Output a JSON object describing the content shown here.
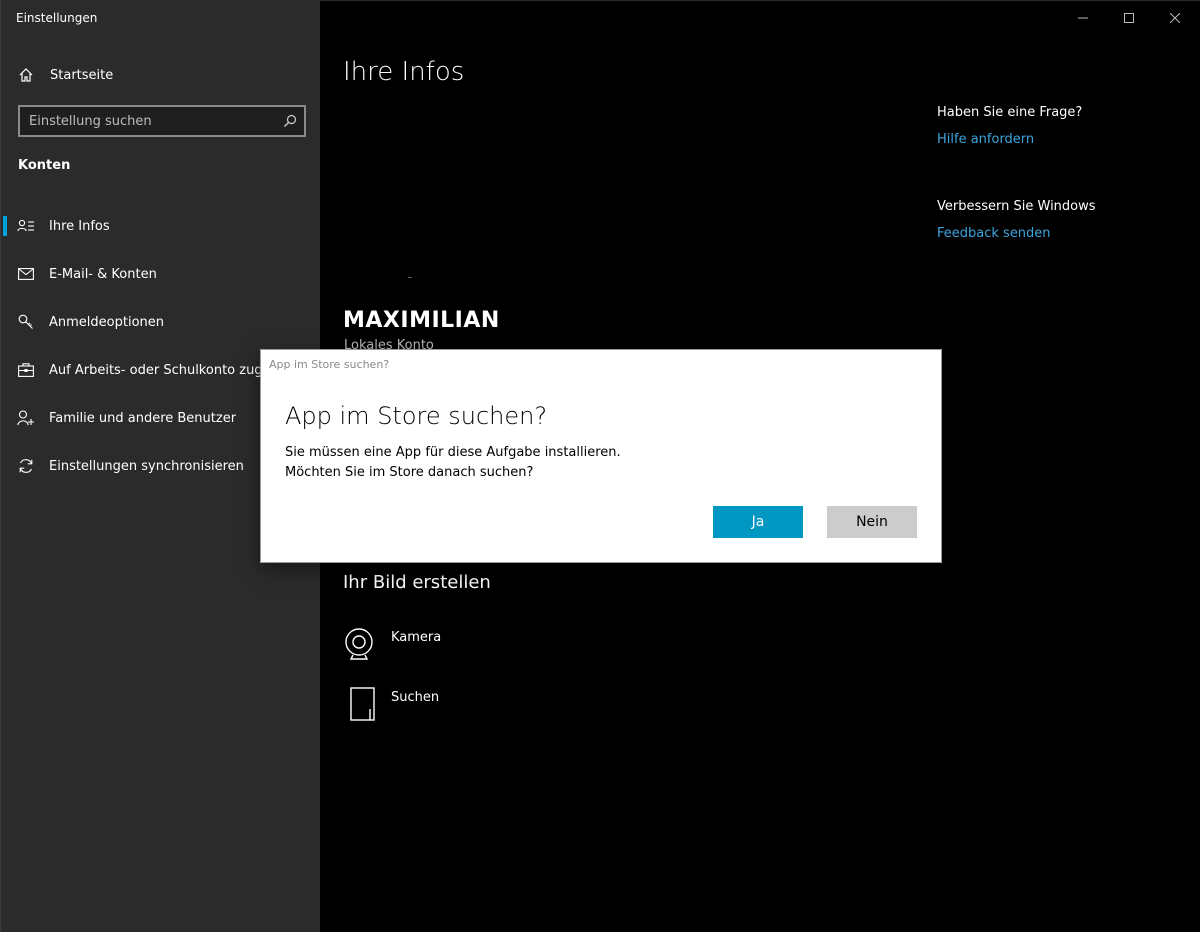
{
  "window": {
    "title": "Einstellungen"
  },
  "sidebar": {
    "home_label": "Startseite",
    "search_placeholder": "Einstellung suchen",
    "section_title": "Konten",
    "items": [
      {
        "label": "Ihre Infos",
        "icon": "person-card-icon",
        "active": true
      },
      {
        "label": "E-Mail- & Konten",
        "icon": "mail-icon",
        "active": false
      },
      {
        "label": "Anmeldeoptionen",
        "icon": "key-icon",
        "active": false
      },
      {
        "label": "Auf Arbeits- oder Schulkonto zugreifen",
        "icon": "briefcase-icon",
        "active": false
      },
      {
        "label": "Familie und andere Benutzer",
        "icon": "person-add-icon",
        "active": false
      },
      {
        "label": "Einstellungen synchronisieren",
        "icon": "sync-icon",
        "active": false
      }
    ]
  },
  "main": {
    "page_title": "Ihre Infos",
    "user_name": "MAXIMILIAN",
    "user_account_type": "Lokales Konto",
    "picture_section_title": "Ihr Bild erstellen",
    "picture_options": [
      {
        "label": "Kamera",
        "icon": "camera-icon"
      },
      {
        "label": "Suchen",
        "icon": "browse-file-icon"
      }
    ],
    "help": {
      "question": "Haben Sie eine Frage?",
      "help_link": "Hilfe anfordern",
      "improve": "Verbessern Sie Windows",
      "feedback_link": "Feedback senden"
    }
  },
  "dialog": {
    "caption": "App im Store suchen?",
    "heading": "App im Store suchen?",
    "line1": "Sie müssen eine App für diese Aufgabe installieren.",
    "line2": "Möchten Sie im Store danach suchen?",
    "yes_label": "Ja",
    "no_label": "Nein"
  },
  "colors": {
    "accent": "#0097c3",
    "link": "#3ba5dd",
    "sidebar_bg": "#2b2b2b",
    "main_bg": "#000000"
  }
}
